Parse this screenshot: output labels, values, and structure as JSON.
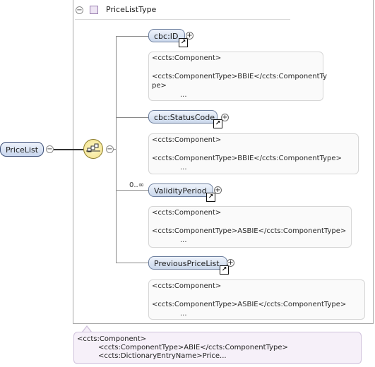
{
  "type_header": {
    "name": "PriceListType"
  },
  "root": {
    "label": "PriceList"
  },
  "cardinality": "0..∞",
  "elements": [
    {
      "label": "cbc:ID",
      "ann_line1": "<ccts:Component>",
      "ann_line2": "<ccts:ComponentType>BBIE</ccts:ComponentTy",
      "ann_line3": "pe>",
      "ann_dots": "..."
    },
    {
      "label": "cbc:StatusCode",
      "ann_line1": "<ccts:Component>",
      "ann_line2": "<ccts:ComponentType>BBIE</ccts:ComponentType>",
      "ann_dots": "..."
    },
    {
      "label": "ValidityPeriod",
      "ann_line1": "<ccts:Component>",
      "ann_line2": "<ccts:ComponentType>ASBIE</ccts:ComponentType>",
      "ann_dots": "..."
    },
    {
      "label": "PreviousPriceList",
      "ann_line1": "<ccts:Component>",
      "ann_line2": "<ccts:ComponentType>ASBIE</ccts:ComponentType>",
      "ann_dots": "..."
    }
  ],
  "bottom_annotation": {
    "line1": "<ccts:Component>",
    "line2": "<ccts:ComponentType>ABIE</ccts:ComponentType>",
    "line3": "<ccts:DictionaryEntryName>Price..."
  },
  "colors": {
    "node_border": "#6d7f9e",
    "sequence_fill": "#f2e08a",
    "annotation_bg": "#f6f0f9"
  }
}
